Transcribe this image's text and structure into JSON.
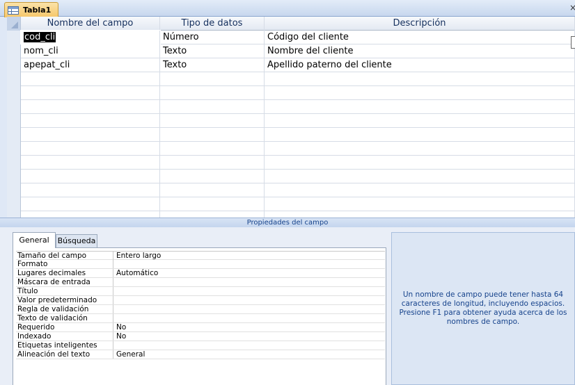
{
  "document_tab": {
    "title": "Tabla1",
    "icon": "table-icon"
  },
  "grid": {
    "columns": [
      "Nombre del campo",
      "Tipo de datos",
      "Descripción"
    ],
    "rows": [
      {
        "name": "cod_cli",
        "type": "Número",
        "description": "Código del cliente"
      },
      {
        "name": "nom_cli",
        "type": "Texto",
        "description": "Nombre del cliente"
      },
      {
        "name": "apepat_cli",
        "type": "Texto",
        "description": "Apellido paterno del cliente"
      }
    ]
  },
  "properties_bar": {
    "label": "Propiedades del campo"
  },
  "properties": {
    "tabs": [
      "General",
      "Búsqueda"
    ],
    "rows": [
      {
        "label": "Tamaño del campo",
        "value": "Entero largo"
      },
      {
        "label": "Formato",
        "value": ""
      },
      {
        "label": "Lugares decimales",
        "value": "Automático"
      },
      {
        "label": "Máscara de entrada",
        "value": ""
      },
      {
        "label": "Título",
        "value": ""
      },
      {
        "label": "Valor predeterminado",
        "value": ""
      },
      {
        "label": "Regla de validación",
        "value": ""
      },
      {
        "label": "Texto de validación",
        "value": ""
      },
      {
        "label": "Requerido",
        "value": "No"
      },
      {
        "label": "Indexado",
        "value": "No"
      },
      {
        "label": "Etiquetas inteligentes",
        "value": ""
      },
      {
        "label": "Alineación del texto",
        "value": "General"
      }
    ]
  },
  "help_text": "Un nombre de campo puede tener hasta 64 caracteres de longitud, incluyendo espacios. Presione F1 para obtener ayuda acerca de los nombres de campo."
}
